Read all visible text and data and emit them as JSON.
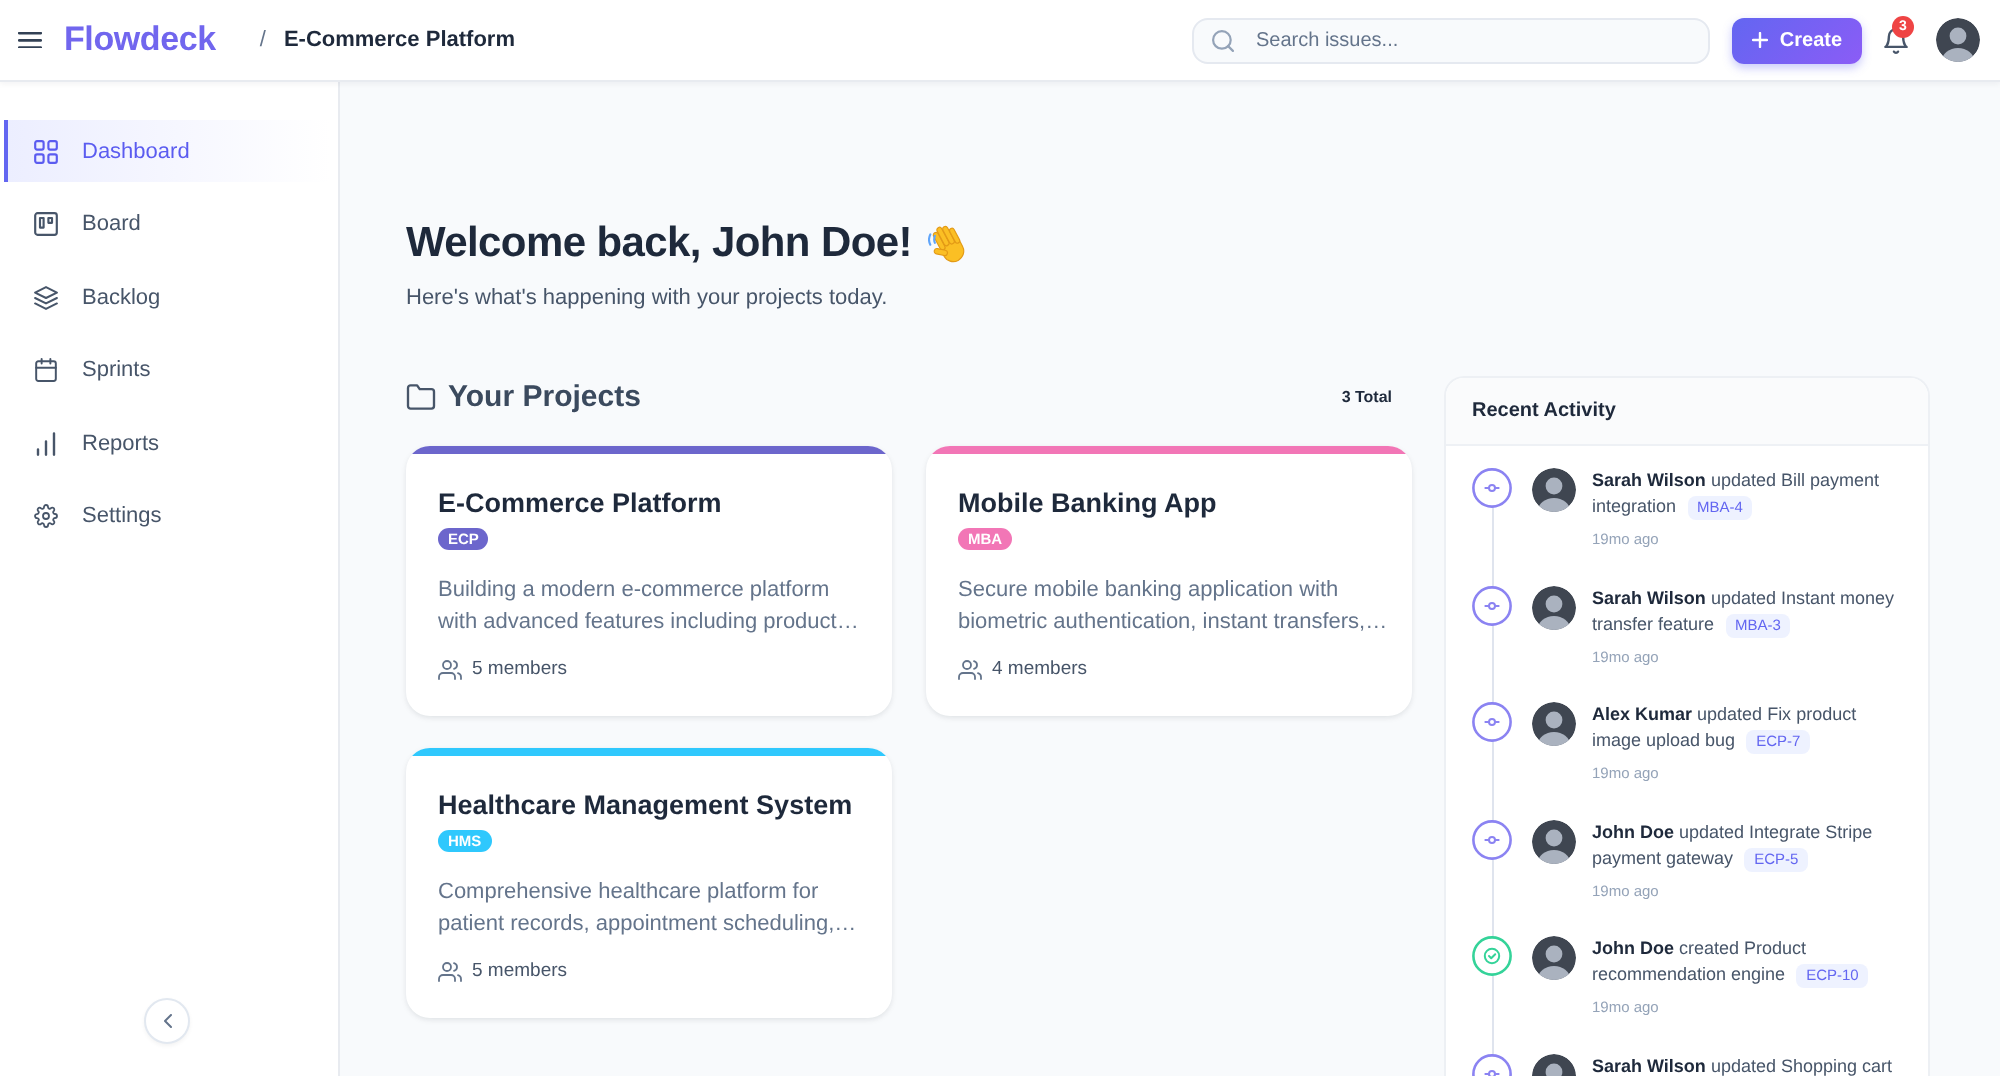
{
  "header": {
    "brand": "Flowdeck",
    "breadcrumb": {
      "separator": "/",
      "current": "E-Commerce Platform"
    },
    "search": {
      "placeholder": "Search issues..."
    },
    "create_button": "Create",
    "notification_count": "3"
  },
  "sidebar": {
    "items": [
      {
        "label": "Dashboard",
        "selected": true
      },
      {
        "label": "Board",
        "selected": false
      },
      {
        "label": "Backlog",
        "selected": false
      },
      {
        "label": "Sprints",
        "selected": false
      },
      {
        "label": "Reports",
        "selected": false
      },
      {
        "label": "Settings",
        "selected": false
      }
    ]
  },
  "welcome": {
    "title": "Welcome back, John Doe!",
    "subtitle": "Here's what's happening with your projects today."
  },
  "projects": {
    "title": "Your Projects",
    "total": "3 Total",
    "items": [
      {
        "name": "E-Commerce Platform",
        "key": "ECP",
        "color": "#6c66cc",
        "description": "Building a modern e-commerce platform with advanced features including product…",
        "members": "5 members"
      },
      {
        "name": "Mobile Banking App",
        "key": "MBA",
        "color": "#f276b6",
        "description": "Secure mobile banking application with biometric authentication, instant transfers,…",
        "members": "4 members"
      },
      {
        "name": "Healthcare Management System",
        "key": "HMS",
        "color": "#2fc8fd",
        "description": "Comprehensive healthcare platform for patient records, appointment scheduling,…",
        "members": "5 members"
      }
    ]
  },
  "recent_activity": {
    "title": "Recent Activity",
    "items": [
      {
        "kind": "update",
        "text": "**Sarah Wilson** updated Bill payment integration",
        "issue": "MBA-4",
        "time": "19mo ago"
      },
      {
        "kind": "update",
        "text": "**Sarah Wilson** updated Instant money transfer feature",
        "issue": "MBA-3",
        "time": "19mo ago"
      },
      {
        "kind": "update",
        "text": "**Alex Kumar** updated Fix product image upload bug",
        "issue": "ECP-7",
        "time": "19mo ago"
      },
      {
        "kind": "update",
        "text": "**John Doe** updated Integrate Stripe payment gateway",
        "issue": "ECP-5",
        "time": "19mo ago"
      },
      {
        "kind": "create",
        "text": "**John Doe** created Product recommendation engine",
        "issue": "ECP-10",
        "time": "19mo ago"
      },
      {
        "kind": "update",
        "text": "**Sarah Wilson** updated Shopping cart"
      }
    ]
  }
}
